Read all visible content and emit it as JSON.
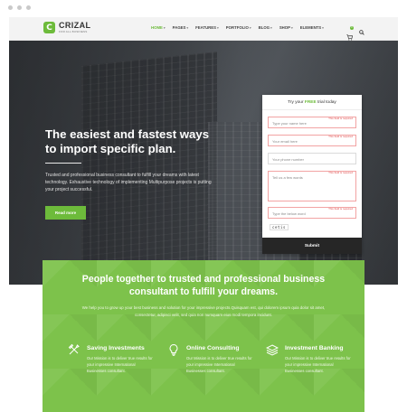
{
  "brand": {
    "name": "CRIZAL",
    "tagline": "FOR ALL BUSINESS",
    "logo_letter": "C",
    "accent_color": "#6dbb3b"
  },
  "nav": {
    "items": [
      {
        "label": "HOME",
        "active": true
      },
      {
        "label": "PAGES",
        "active": false
      },
      {
        "label": "FEATURES",
        "active": false
      },
      {
        "label": "PORTFOLIO",
        "active": false
      },
      {
        "label": "BLOG",
        "active": false
      },
      {
        "label": "SHOP",
        "active": false
      },
      {
        "label": "ELEMENTS",
        "active": false
      }
    ],
    "cart_count": "0",
    "icons": [
      "cart-icon",
      "search-icon"
    ]
  },
  "hero": {
    "title_line1": "The easiest and fastest ways",
    "title_line2": "to import specific plan.",
    "text": "Trusted and professional business consultant to fulfill your dreams with latest technology. Exhaustive technology of implementing Multipurpose projects is putting your project successful.",
    "button_label": "Read more"
  },
  "form": {
    "title_prefix": "Try your ",
    "title_highlight": "FREE",
    "title_suffix": " trial today",
    "fields": [
      {
        "placeholder": "Type your name here",
        "error": "This field is required"
      },
      {
        "placeholder": "Your email here",
        "error": "This field is required"
      },
      {
        "placeholder": "Your phone number",
        "error": ""
      },
      {
        "placeholder": "Tell us a few words",
        "error": "This field is required"
      },
      {
        "placeholder": "Type the below word",
        "error": "This field is required"
      }
    ],
    "captcha": "cetis",
    "submit_label": "Submit"
  },
  "cta": {
    "title_line1": "People together to trusted and professional business",
    "title_line2": "consultant to fulfill your dreams.",
    "text": "We help you to grow up your best business and solution for your impressive projects.Quisquam est, qui dolorem ipsum quia dolor sit amet, consectetur, adipisci velit, sed quia non numquam eius modi tempora incidunt.",
    "features": [
      {
        "icon": "tools-icon",
        "title": "Saving Investments",
        "desc": "Our Mission is to deliver true results for your impressive International Businesses consultant."
      },
      {
        "icon": "lightbulb-icon",
        "title": "Online Consulting",
        "desc": "Our Mission is to deliver true results for your impressive International Businesses consultant."
      },
      {
        "icon": "layers-icon",
        "title": "Investment Banking",
        "desc": "Our Mission is to deliver true results for your impressive International Businesses consultant."
      }
    ]
  }
}
